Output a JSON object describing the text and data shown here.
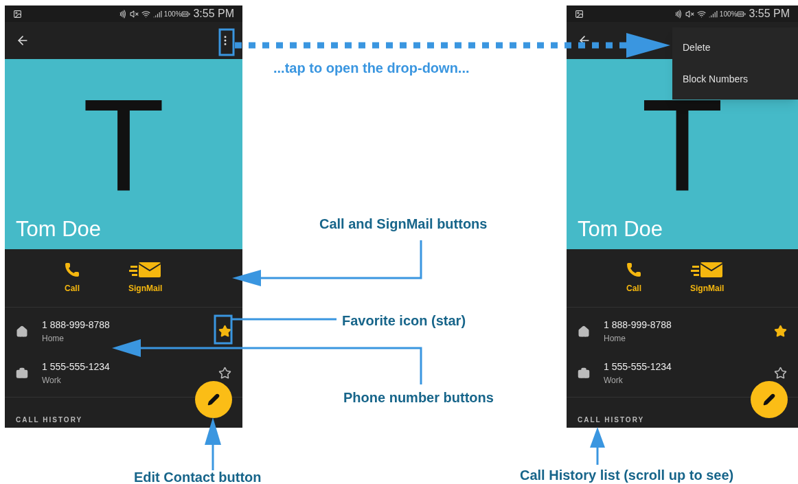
{
  "screens": [
    {
      "status_bar": {
        "battery": "100%",
        "time": "3:55 PM"
      },
      "contact": {
        "initial": "T",
        "name": "Tom Doe"
      },
      "actions": [
        {
          "kind": "call",
          "label": "Call"
        },
        {
          "kind": "signmail",
          "label": "SignMail"
        }
      ],
      "phones": [
        {
          "kind": "home",
          "number": "1 888-999-8788",
          "type": "Home",
          "favorite": true
        },
        {
          "kind": "work",
          "number": "1 555-555-1234",
          "type": "Work",
          "favorite": false
        }
      ],
      "section": "CALL HISTORY"
    },
    {
      "status_bar": {
        "battery": "100%",
        "time": "3:55 PM"
      },
      "contact": {
        "initial": "T",
        "name": "Tom Doe"
      },
      "actions": [
        {
          "kind": "call",
          "label": "Call"
        },
        {
          "kind": "signmail",
          "label": "SignMail"
        }
      ],
      "phones": [
        {
          "kind": "home",
          "number": "1 888-999-8788",
          "type": "Home",
          "favorite": true
        },
        {
          "kind": "work",
          "number": "1 555-555-1234",
          "type": "Work",
          "favorite": false
        }
      ],
      "section": "CALL HISTORY",
      "menu": [
        "Delete",
        "Block Numbers"
      ]
    }
  ],
  "callouts": {
    "dropdown": "...tap to open the drop-down...",
    "buttons": "Call and SignMail buttons",
    "favorite": "Favorite icon (star)",
    "phone_numbers": "Phone number buttons",
    "edit": "Edit Contact button",
    "call_history": "Call History list (scroll up to see)"
  }
}
